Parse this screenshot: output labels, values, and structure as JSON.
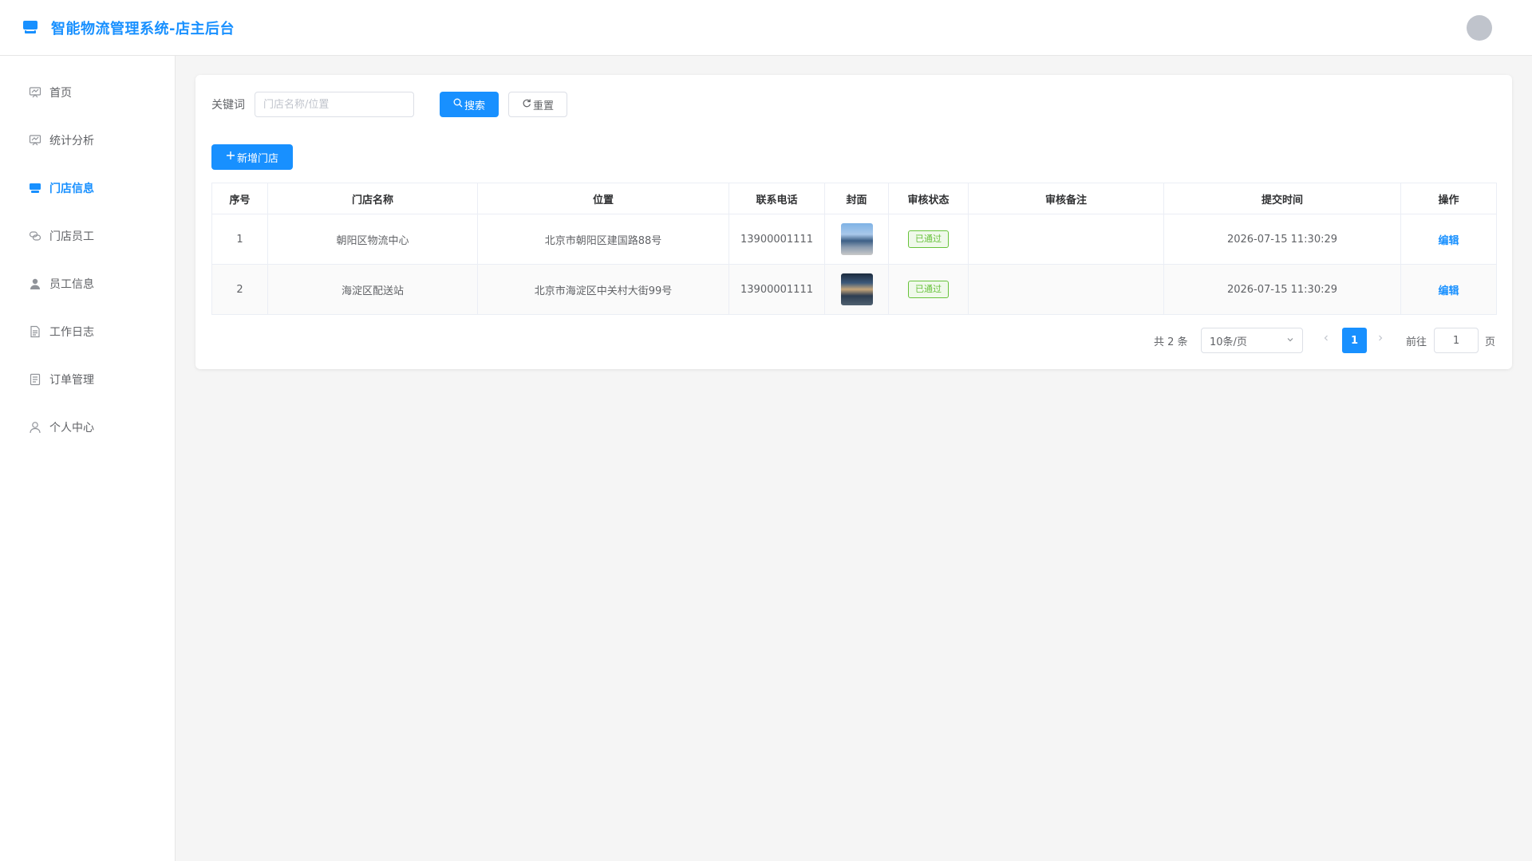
{
  "app": {
    "title": "智能物流管理系统-店主后台"
  },
  "sidebar": {
    "items": [
      {
        "label": "首页",
        "icon": "chart-icon"
      },
      {
        "label": "统计分析",
        "icon": "chart-icon"
      },
      {
        "label": "门店信息",
        "icon": "store-icon",
        "active": true
      },
      {
        "label": "门店员工",
        "icon": "link-icon"
      },
      {
        "label": "员工信息",
        "icon": "user-filled-icon"
      },
      {
        "label": "工作日志",
        "icon": "document-icon"
      },
      {
        "label": "订单管理",
        "icon": "list-icon"
      },
      {
        "label": "个人中心",
        "icon": "user-icon"
      }
    ]
  },
  "search": {
    "label": "关键词",
    "placeholder": "门店名称/位置",
    "value": "",
    "search_button": "搜索",
    "reset_button": "重置"
  },
  "toolbar": {
    "add_button": "新增门店"
  },
  "table": {
    "columns": [
      "序号",
      "门店名称",
      "位置",
      "联系电话",
      "封面",
      "审核状态",
      "审核备注",
      "提交时间",
      "操作"
    ],
    "rows": [
      {
        "index": "1",
        "name": "朝阳区物流中心",
        "location": "北京市朝阳区建国路88号",
        "phone": "13900001111",
        "status": "已通过",
        "remark": "",
        "time": "2026-07-15 11:30:29",
        "action": "编辑"
      },
      {
        "index": "2",
        "name": "海淀区配送站",
        "location": "北京市海淀区中关村大街99号",
        "phone": "13900001111",
        "status": "已通过",
        "remark": "",
        "time": "2026-07-15 11:30:29",
        "action": "编辑"
      }
    ]
  },
  "pagination": {
    "total_text": "共 2 条",
    "page_size": "10条/页",
    "current_page": "1",
    "goto_label": "前往",
    "goto_value": "1",
    "page_suffix": "页"
  },
  "colors": {
    "primary": "#1890ff",
    "success": "#67c23a"
  }
}
